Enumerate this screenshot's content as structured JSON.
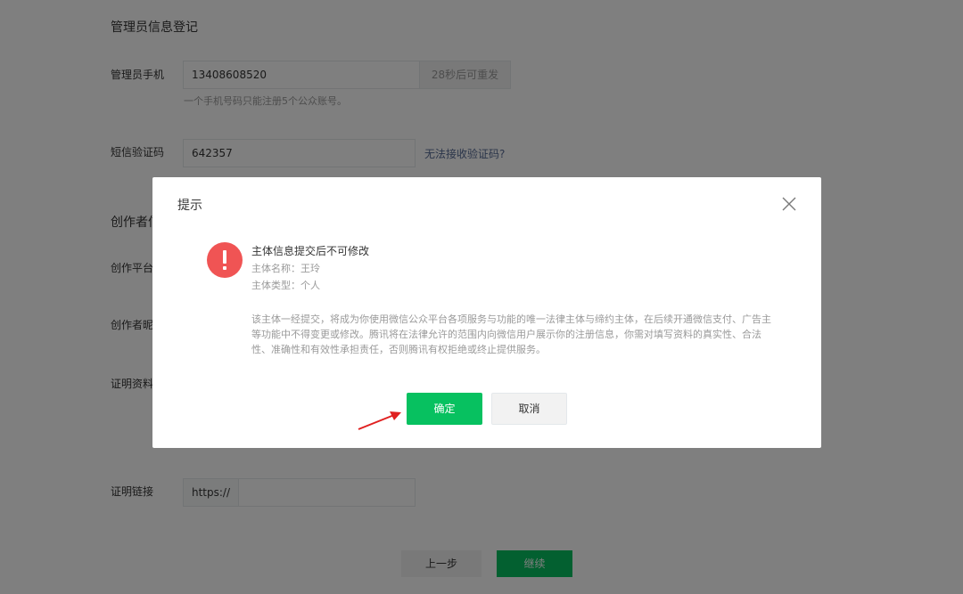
{
  "form": {
    "section_admin_title": "管理员信息登记",
    "phone_label": "管理员手机",
    "phone_value": "13408608520",
    "resend_label": "28秒后可重发",
    "phone_hint": "一个手机号码只能注册5个公众账号。",
    "sms_label": "短信验证码",
    "sms_value": "642357",
    "sms_help": "无法接收验证码?",
    "section_creator_title": "创作者信",
    "platform_label": "创作平台",
    "nickname_label": "创作者昵",
    "proof_material_label": "证明资料",
    "proof_link_label": "证明链接",
    "proof_link_prefix": "https://",
    "prev_label": "上一步",
    "next_label": "继续"
  },
  "dialog": {
    "title": "提示",
    "close_icon": "close-icon",
    "warning_icon": "exclamation-circle-icon",
    "message_title": "主体信息提交后不可修改",
    "subject_name": "主体名称：王玲",
    "subject_type": "主体类型：个人",
    "description": "该主体一经提交，将成为你使用微信公众平台各项服务与功能的唯一法律主体与缔约主体，在后续开通微信支付、广告主等功能中不得变更或修改。腾讯将在法律允许的范围内向微信用户展示你的注册信息，你需对填写资料的真实性、合法性、准确性和有效性承担责任，否则腾讯有权拒绝或终止提供服务。",
    "confirm_label": "确定",
    "cancel_label": "取消"
  },
  "colors": {
    "primary": "#07c160",
    "warning": "#f05454",
    "annotation_arrow": "#e02020"
  }
}
